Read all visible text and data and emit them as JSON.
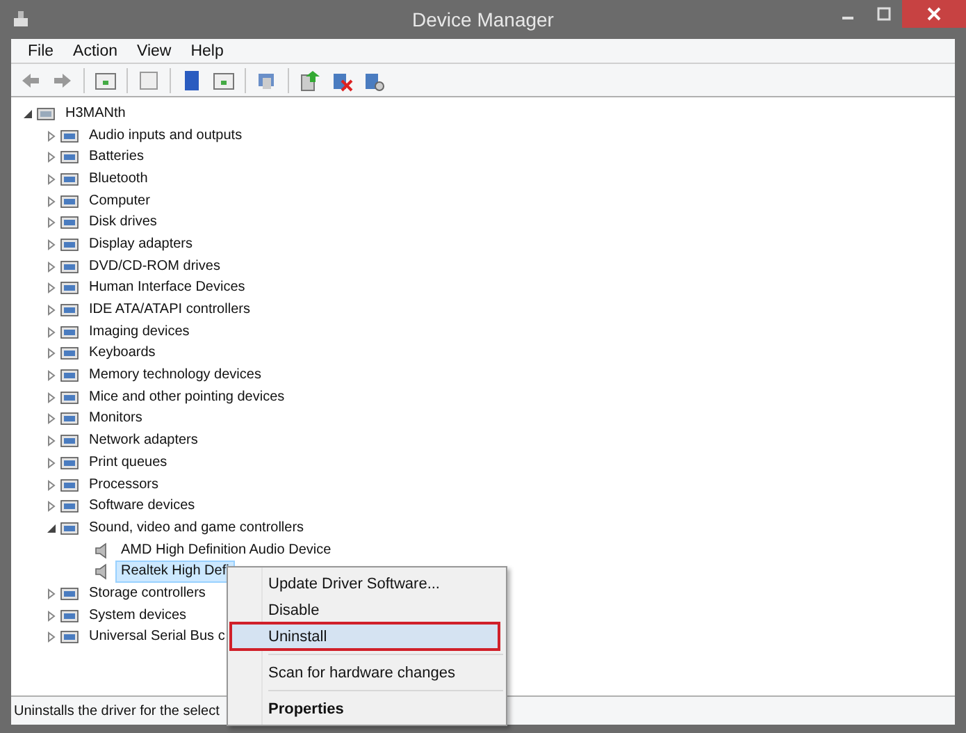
{
  "window": {
    "title": "Device Manager"
  },
  "menu": [
    "File",
    "Action",
    "View",
    "Help"
  ],
  "tree": {
    "label": "H3MANth",
    "expanded": true,
    "selected": false,
    "children": [
      {
        "label": "Audio inputs and outputs",
        "expanded": false,
        "selected": false
      },
      {
        "label": "Batteries",
        "expanded": false,
        "selected": false
      },
      {
        "label": "Bluetooth",
        "expanded": false,
        "selected": false
      },
      {
        "label": "Computer",
        "expanded": false,
        "selected": false
      },
      {
        "label": "Disk drives",
        "expanded": false,
        "selected": false
      },
      {
        "label": "Display adapters",
        "expanded": false,
        "selected": false
      },
      {
        "label": "DVD/CD-ROM drives",
        "expanded": false,
        "selected": false
      },
      {
        "label": "Human Interface Devices",
        "expanded": false,
        "selected": false
      },
      {
        "label": "IDE ATA/ATAPI controllers",
        "expanded": false,
        "selected": false
      },
      {
        "label": "Imaging devices",
        "expanded": false,
        "selected": false
      },
      {
        "label": "Keyboards",
        "expanded": false,
        "selected": false
      },
      {
        "label": "Memory technology devices",
        "expanded": false,
        "selected": false
      },
      {
        "label": "Mice and other pointing devices",
        "expanded": false,
        "selected": false
      },
      {
        "label": "Monitors",
        "expanded": false,
        "selected": false
      },
      {
        "label": "Network adapters",
        "expanded": false,
        "selected": false
      },
      {
        "label": "Print queues",
        "expanded": false,
        "selected": false
      },
      {
        "label": "Processors",
        "expanded": false,
        "selected": false
      },
      {
        "label": "Software devices",
        "expanded": false,
        "selected": false
      },
      {
        "label": "Sound, video and game controllers",
        "expanded": true,
        "selected": false,
        "children": [
          {
            "label": "AMD High Definition Audio Device",
            "selected": false
          },
          {
            "label": "Realtek High Defi",
            "selected": true
          }
        ]
      },
      {
        "label": "Storage controllers",
        "expanded": false,
        "selected": false
      },
      {
        "label": "System devices",
        "expanded": false,
        "selected": false
      },
      {
        "label": "Universal Serial Bus c",
        "expanded": false,
        "selected": false
      }
    ]
  },
  "context_menu": [
    {
      "kind": "item",
      "label": "Update Driver Software...",
      "selected": false
    },
    {
      "kind": "item",
      "label": "Disable",
      "selected": false
    },
    {
      "kind": "item",
      "label": "Uninstall",
      "selected": true
    },
    {
      "kind": "separator"
    },
    {
      "kind": "item",
      "label": "Scan for hardware changes",
      "selected": false
    },
    {
      "kind": "separator"
    },
    {
      "kind": "default",
      "label": "Properties",
      "selected": false
    }
  ],
  "status_bar": "Uninstalls the driver for the select"
}
